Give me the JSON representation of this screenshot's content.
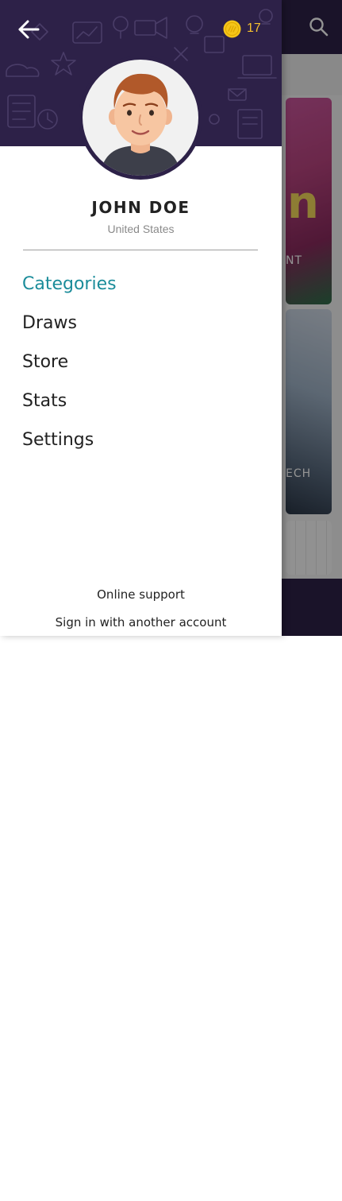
{
  "header": {
    "coin_count": "17"
  },
  "user": {
    "name": "JOHN DOE",
    "country": "United States"
  },
  "menu": {
    "items": [
      {
        "label": "Categories",
        "active": true
      },
      {
        "label": "Draws",
        "active": false
      },
      {
        "label": "Store",
        "active": false
      },
      {
        "label": "Stats",
        "active": false
      },
      {
        "label": "Settings",
        "active": false
      }
    ]
  },
  "footer": {
    "support_label": "Online support",
    "switch_account_label": "Sign in with another account"
  },
  "background": {
    "card1_label": "NT",
    "card1_letter": "n",
    "card2_label": "ECH"
  },
  "colors": {
    "header_bg": "#2d2148",
    "active_item": "#1b8c9a",
    "coin": "#f5c12e",
    "text": "#222222",
    "subtext": "#8a8a8a"
  },
  "icons": {
    "back": "arrow-left-icon",
    "coin": "coin-icon",
    "search": "search-icon",
    "profile": "person-icon"
  }
}
